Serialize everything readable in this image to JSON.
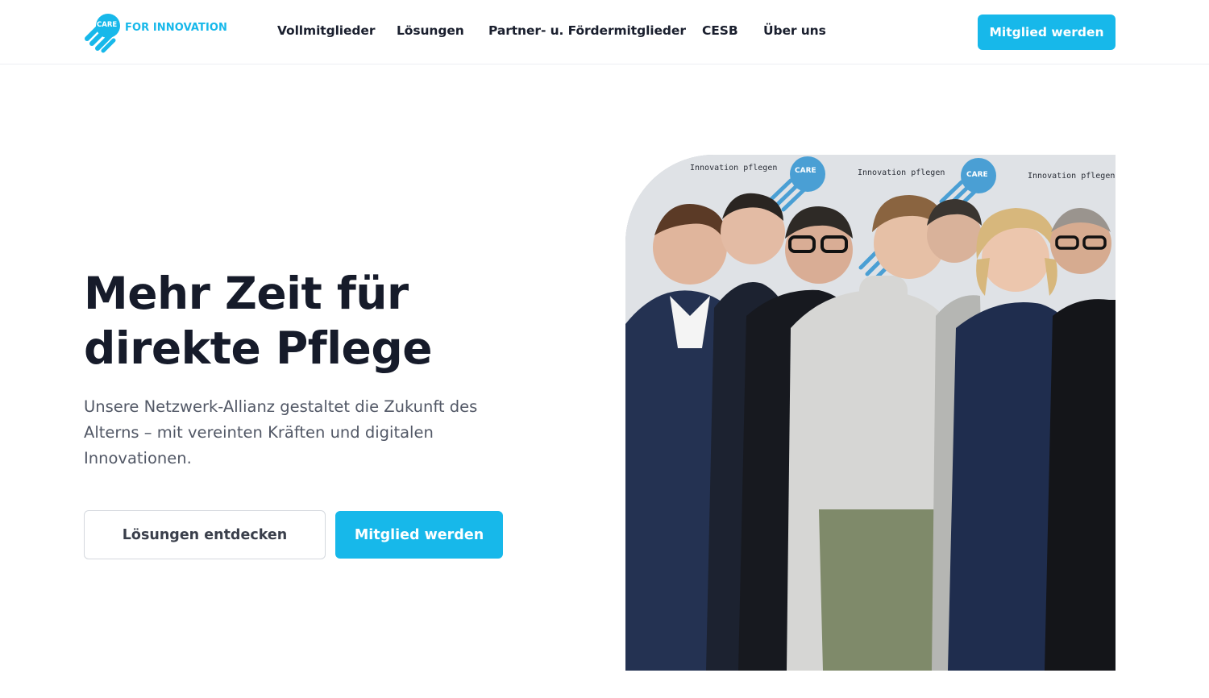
{
  "header": {
    "logo": {
      "mark_text": "CARE",
      "brand_text": "FOR INNOVATION"
    },
    "nav": [
      {
        "label": "Vollmitglieder"
      },
      {
        "label": "Lösungen"
      },
      {
        "label": "Partner- u. Fördermitglieder"
      },
      {
        "label": "CESB"
      },
      {
        "label": "Über uns"
      }
    ],
    "cta_label": "Mitglied werden"
  },
  "hero": {
    "title": "Mehr Zeit für direkte Pflege",
    "subtitle": "Unsere Netzwerk-Allianz gestaltet die Zukunft des Alterns – mit vereinten Kräften und digitalen Innovationen.",
    "primary_button_label": "Mitglied werden",
    "secondary_button_label": "Lösungen entdecken"
  },
  "photo": {
    "backdrop_text": "Innovation pflegen",
    "backdrop_logo_text": "CARE"
  },
  "colors": {
    "accent": "#17b8ea",
    "text_dark": "#161b2a",
    "text_muted": "#525866"
  }
}
